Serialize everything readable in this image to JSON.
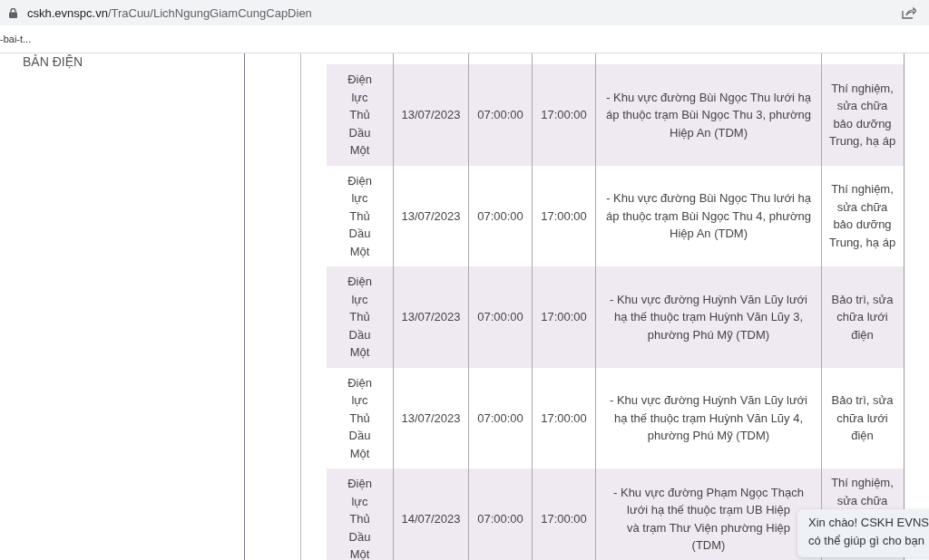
{
  "browser": {
    "url_host": "cskh.evnspc.vn",
    "url_path": "/TraCuu/LichNgungGiamCungCapDien",
    "bookmark": "-bai-t..."
  },
  "sidebar": {
    "heading": "BẢN ĐIỆN"
  },
  "table": {
    "rows": [
      {
        "unit": "Điện lực Thủ Dầu Một",
        "date": "13/07/2023",
        "start": "07:00:00",
        "end": "17:00:00",
        "area": "- Khu vực đường Bùi Ngọc Thu lưới hạ áp thuộc trạm Bùi Ngọc Thu 3, phường Hiệp An (TDM)",
        "reason": "Thí nghiệm, sửa chữa bảo dưỡng Trung, hạ áp"
      },
      {
        "unit": "Điện lực Thủ Dầu Một",
        "date": "13/07/2023",
        "start": "07:00:00",
        "end": "17:00:00",
        "area": "- Khu vực đường Bùi Ngọc Thu lưới hạ áp thuộc trạm Bùi Ngọc Thu 4, phường Hiệp An (TDM)",
        "reason": "Thí nghiệm, sửa chữa bảo dưỡng Trung, hạ áp"
      },
      {
        "unit": "Điện lực Thủ Dầu Một",
        "date": "13/07/2023",
        "start": "07:00:00",
        "end": "17:00:00",
        "area": "- Khu vực đường Huỳnh Văn Lũy lưới hạ thế thuộc trạm Huỳnh Văn Lũy 3, phường Phú Mỹ (TDM)",
        "reason": "Bảo trì, sửa chữa lưới điện"
      },
      {
        "unit": "Điện lực Thủ Dầu Một",
        "date": "13/07/2023",
        "start": "07:00:00",
        "end": "17:00:00",
        "area": "- Khu vực đường Huỳnh Văn Lũy lưới hạ thế thuộc trạm Huỳnh Văn Lũy 4, phường Phú Mỹ (TDM)",
        "reason": "Bảo trì, sửa chữa lưới điện"
      },
      {
        "unit": "Điện lực Thủ Dầu Một",
        "date": "14/07/2023",
        "start": "07:00:00",
        "end": "17:00:00",
        "area": "- Khu vực đường Phạm Ngọc Thạch\nlưới hạ thế thuộc trạm UB Hiệp\nvà trạm Thư Viện phường Hiệp\n(TDM)",
        "reason": "Thí nghiệm, sửa chữa"
      }
    ]
  },
  "chat_popup": {
    "lines": [
      "Xin chào! CSKH EVNS",
      "có thể giúp gì cho bạn"
    ]
  }
}
